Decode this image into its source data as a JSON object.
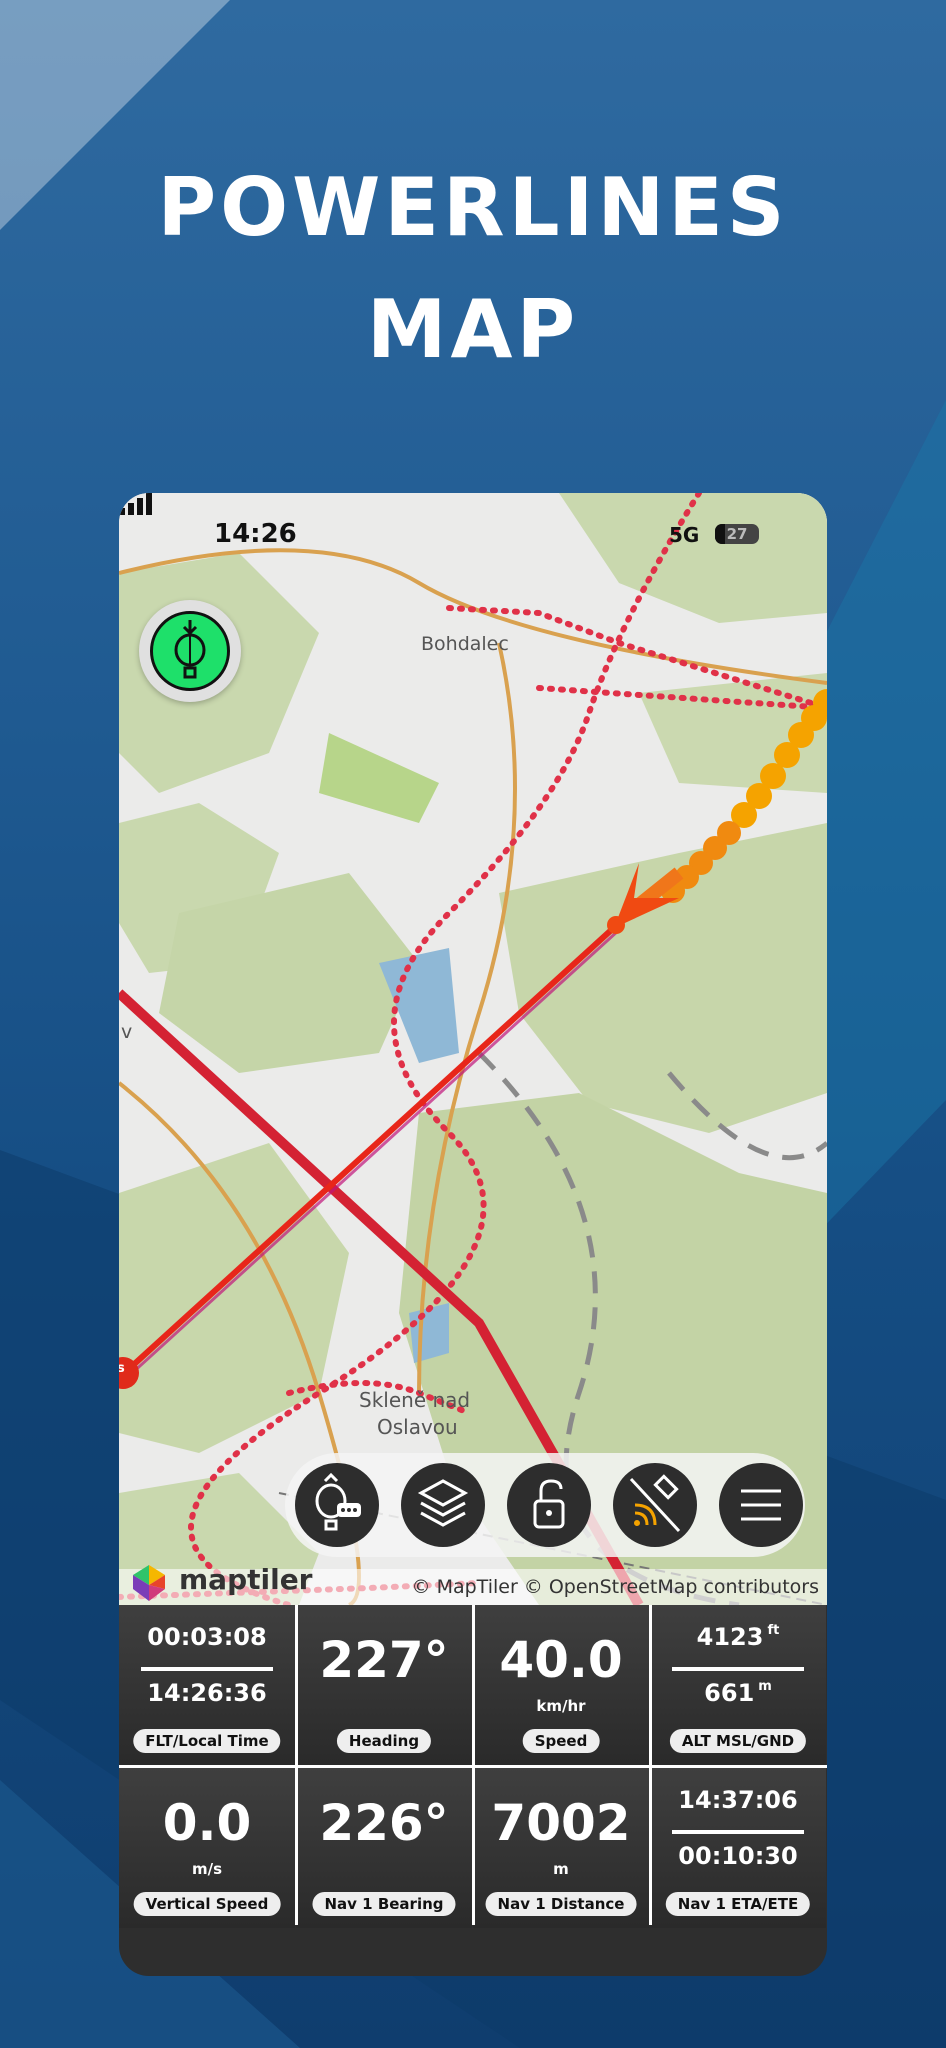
{
  "promo": {
    "title_line1": "POWERLINES",
    "title_line2": "MAP"
  },
  "status_bar": {
    "time": "14:26",
    "network": "5G",
    "battery": "27"
  },
  "map": {
    "labels": [
      "Bohdalec",
      "Skleně nad",
      "Oslavou",
      "v",
      "s"
    ],
    "attribution": "© MapTiler © OpenStreetMap contributors",
    "logo_text": "maptiler"
  },
  "controls": [
    "balloon-chat",
    "layers",
    "lock",
    "satellite-signal",
    "menu"
  ],
  "instruments": [
    {
      "top": "00:03:08",
      "bottom": "14:26:36",
      "label": "FLT/Local Time"
    },
    {
      "value": "227°",
      "unit": "",
      "label": "Heading"
    },
    {
      "value": "40.0",
      "unit": "km/hr",
      "label": "Speed"
    },
    {
      "top": "4123",
      "top_unit": "ft",
      "bottom": "661",
      "bottom_unit": "m",
      "label": "ALT MSL/GND"
    },
    {
      "value": "0.0",
      "unit": "m/s",
      "label": "Vertical Speed"
    },
    {
      "value": "226°",
      "unit": "",
      "label": "Nav 1 Bearing"
    },
    {
      "value": "7002",
      "unit": "m",
      "label": "Nav 1 Distance"
    },
    {
      "top": "14:37:06",
      "bottom": "00:10:30",
      "label": "Nav 1 ETA/ETE"
    }
  ],
  "colors": {
    "accent_green": "#1ee06a",
    "powerline_red": "#e03148",
    "track_orange": "#f5a300"
  }
}
